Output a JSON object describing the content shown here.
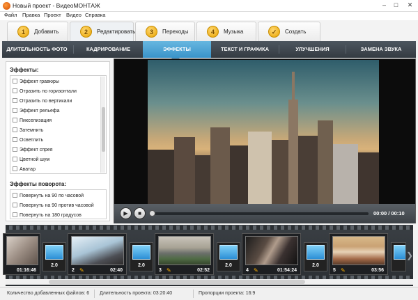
{
  "window": {
    "title": "Новый проект - ВидеоМОНТАЖ",
    "min": "–",
    "max": "□",
    "close": "✕"
  },
  "menu": [
    "Файл",
    "Правка",
    "Проект",
    "Видео",
    "Справка"
  ],
  "steps": [
    {
      "num": "1",
      "label": "Добавить"
    },
    {
      "num": "2",
      "label": "Редактировать",
      "active": true
    },
    {
      "num": "3",
      "label": "Переходы"
    },
    {
      "num": "4",
      "label": "Музыка"
    },
    {
      "num": "✓",
      "label": "Создать"
    }
  ],
  "subtabs": [
    "ДЛИТЕЛЬНОСТЬ ФОТО",
    "КАДРИРОВАНИЕ",
    "ЭФФЕКТЫ",
    "ТЕКСТ И ГРАФИКА",
    "УЛУЧШЕНИЯ",
    "ЗАМЕНА ЗВУКА"
  ],
  "active_subtab": "ЭФФЕКТЫ",
  "effects": {
    "title": "Эффекты:",
    "items": [
      "Эффект гравюры",
      "Отразить по горизонтали",
      "Отразить по вертикали",
      "Эффект рельефа",
      "Пикселизация",
      "Затемнить",
      "Осветлить",
      "Эффект спрея",
      "Цветной шум",
      "Аватар"
    ]
  },
  "rotation": {
    "title": "Эффекты поворота:",
    "items": [
      "Повернуть на 90 по часовой",
      "Повернуть на 90 против часовой",
      "Повернуть на 180 градусов"
    ]
  },
  "player": {
    "play": "▶",
    "stop": "■",
    "time": "00:00 / 00:10",
    "progress": 0
  },
  "timeline": {
    "clips": [
      {
        "num": "",
        "duration": "01:16:46"
      },
      {
        "num": "2",
        "duration": "02:40"
      },
      {
        "num": "3",
        "duration": "02:52"
      },
      {
        "num": "4",
        "duration": "01:54:24"
      },
      {
        "num": "5",
        "duration": "03:56"
      }
    ],
    "transitions": [
      "2.0",
      "2.0",
      "2.0",
      "2.0",
      "2.0"
    ],
    "prev": "❮",
    "next": "❯"
  },
  "status": {
    "files": "Количество добавленных файлов: 6",
    "duration": "Длительность проекта: 03:20:40",
    "ratio": "Пропорции проекта: 16:9"
  }
}
